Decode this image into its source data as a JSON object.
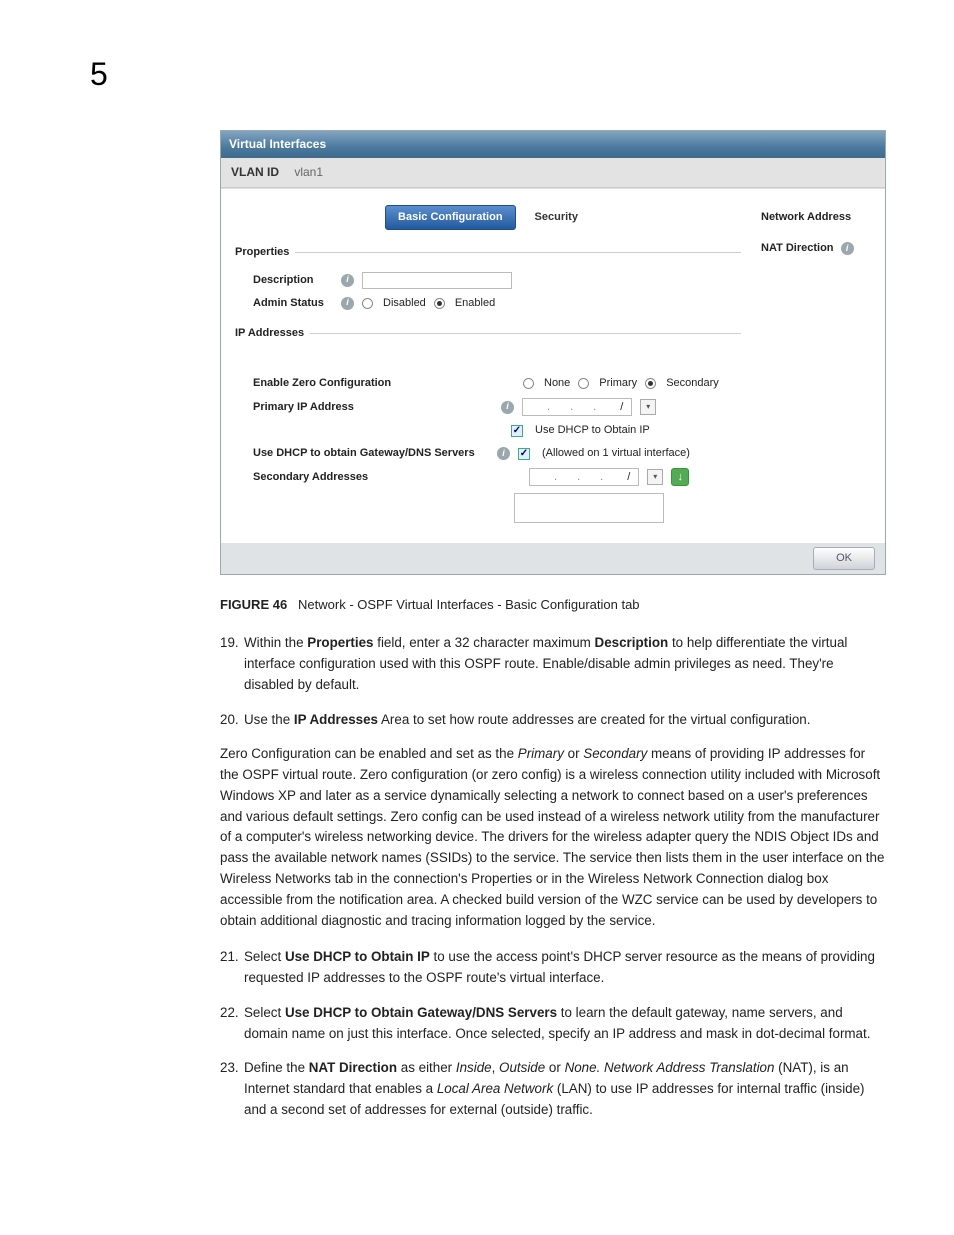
{
  "chapter_number": "5",
  "screenshot": {
    "title": "Virtual Interfaces",
    "vlan_label": "VLAN ID",
    "vlan_value": "vlan1",
    "tabs": {
      "basic": "Basic Configuration",
      "security": "Security"
    },
    "properties": {
      "legend": "Properties",
      "description_label": "Description",
      "admin_status_label": "Admin Status",
      "disabled": "Disabled",
      "enabled": "Enabled"
    },
    "ip": {
      "legend": "IP Addresses",
      "zero_conf_label": "Enable Zero Configuration",
      "zc_none": "None",
      "zc_primary": "Primary",
      "zc_secondary": "Secondary",
      "primary_ip_label": "Primary IP Address",
      "dhcp_ip": "Use DHCP to Obtain IP",
      "dhcp_gw_label": "Use DHCP to obtain Gateway/DNS Servers",
      "dhcp_gw_note": "(Allowed on 1 virtual interface)",
      "secondary_label": "Secondary Addresses",
      "slash": "/"
    },
    "right": {
      "net_addr": "Network Address",
      "nat_dir": "NAT Direction"
    },
    "ok": "OK"
  },
  "figure": {
    "label": "FIGURE 46",
    "caption": "Network - OSPF Virtual Interfaces - Basic Configuration tab"
  },
  "steps": {
    "s19": {
      "num": "19.",
      "pre": "Within the ",
      "b1": "Properties",
      "mid1": " field, enter a 32 character maximum ",
      "b2": "Description",
      "post": " to help differentiate the virtual interface configuration used with this OSPF route. Enable/disable admin privileges as need. They're disabled by default."
    },
    "s20": {
      "num": "20.",
      "pre": "Use the ",
      "b1": "IP Addresses",
      "post": " Area to set how route addresses are created for the virtual configuration."
    },
    "p": {
      "t1": "Zero Configuration can be enabled and set as the ",
      "i1": "Primary",
      "t2": " or ",
      "i2": "Secondary",
      "t3": " means of providing IP addresses for the OSPF virtual route. Zero configuration (or zero config) is a wireless connection utility included with Microsoft Windows XP and later as a service dynamically selecting a network to connect based on a user's preferences and various default settings. Zero config can be used instead of a wireless network utility from the manufacturer of a computer's wireless networking device. The drivers for the wireless adapter query the NDIS Object IDs and pass the available network names (SSIDs) to the service. The service then lists them in the user interface on the Wireless Networks tab in the connection's Properties or in the Wireless Network Connection dialog box accessible from the notification area. A checked build version of the WZC service can be used by developers to obtain additional diagnostic and tracing information logged by the service."
    },
    "s21": {
      "num": "21.",
      "pre": "Select ",
      "b1": "Use DHCP to Obtain IP",
      "post": " to use the access point's DHCP server resource as the means of providing requested IP addresses to the OSPF route's virtual interface."
    },
    "s22": {
      "num": "22.",
      "pre": "Select ",
      "b1": "Use DHCP to Obtain Gateway/DNS Servers",
      "post": " to learn the default gateway, name servers, and domain name on just this interface. Once selected, specify an IP address and mask in dot-decimal format."
    },
    "s23": {
      "num": "23.",
      "pre": "Define the ",
      "b1": "NAT Direction",
      "mid1": " as either ",
      "i1": "Inside",
      "c1": ", ",
      "i2": "Outside",
      "mid2": " or ",
      "i3": "None. Network Address Translation",
      "mid3": " (NAT), is an Internet standard that enables a ",
      "i4": "Local Area Network",
      "post": " (LAN) to use IP addresses for internal traffic (inside) and a second set of addresses for external (outside) traffic."
    }
  }
}
